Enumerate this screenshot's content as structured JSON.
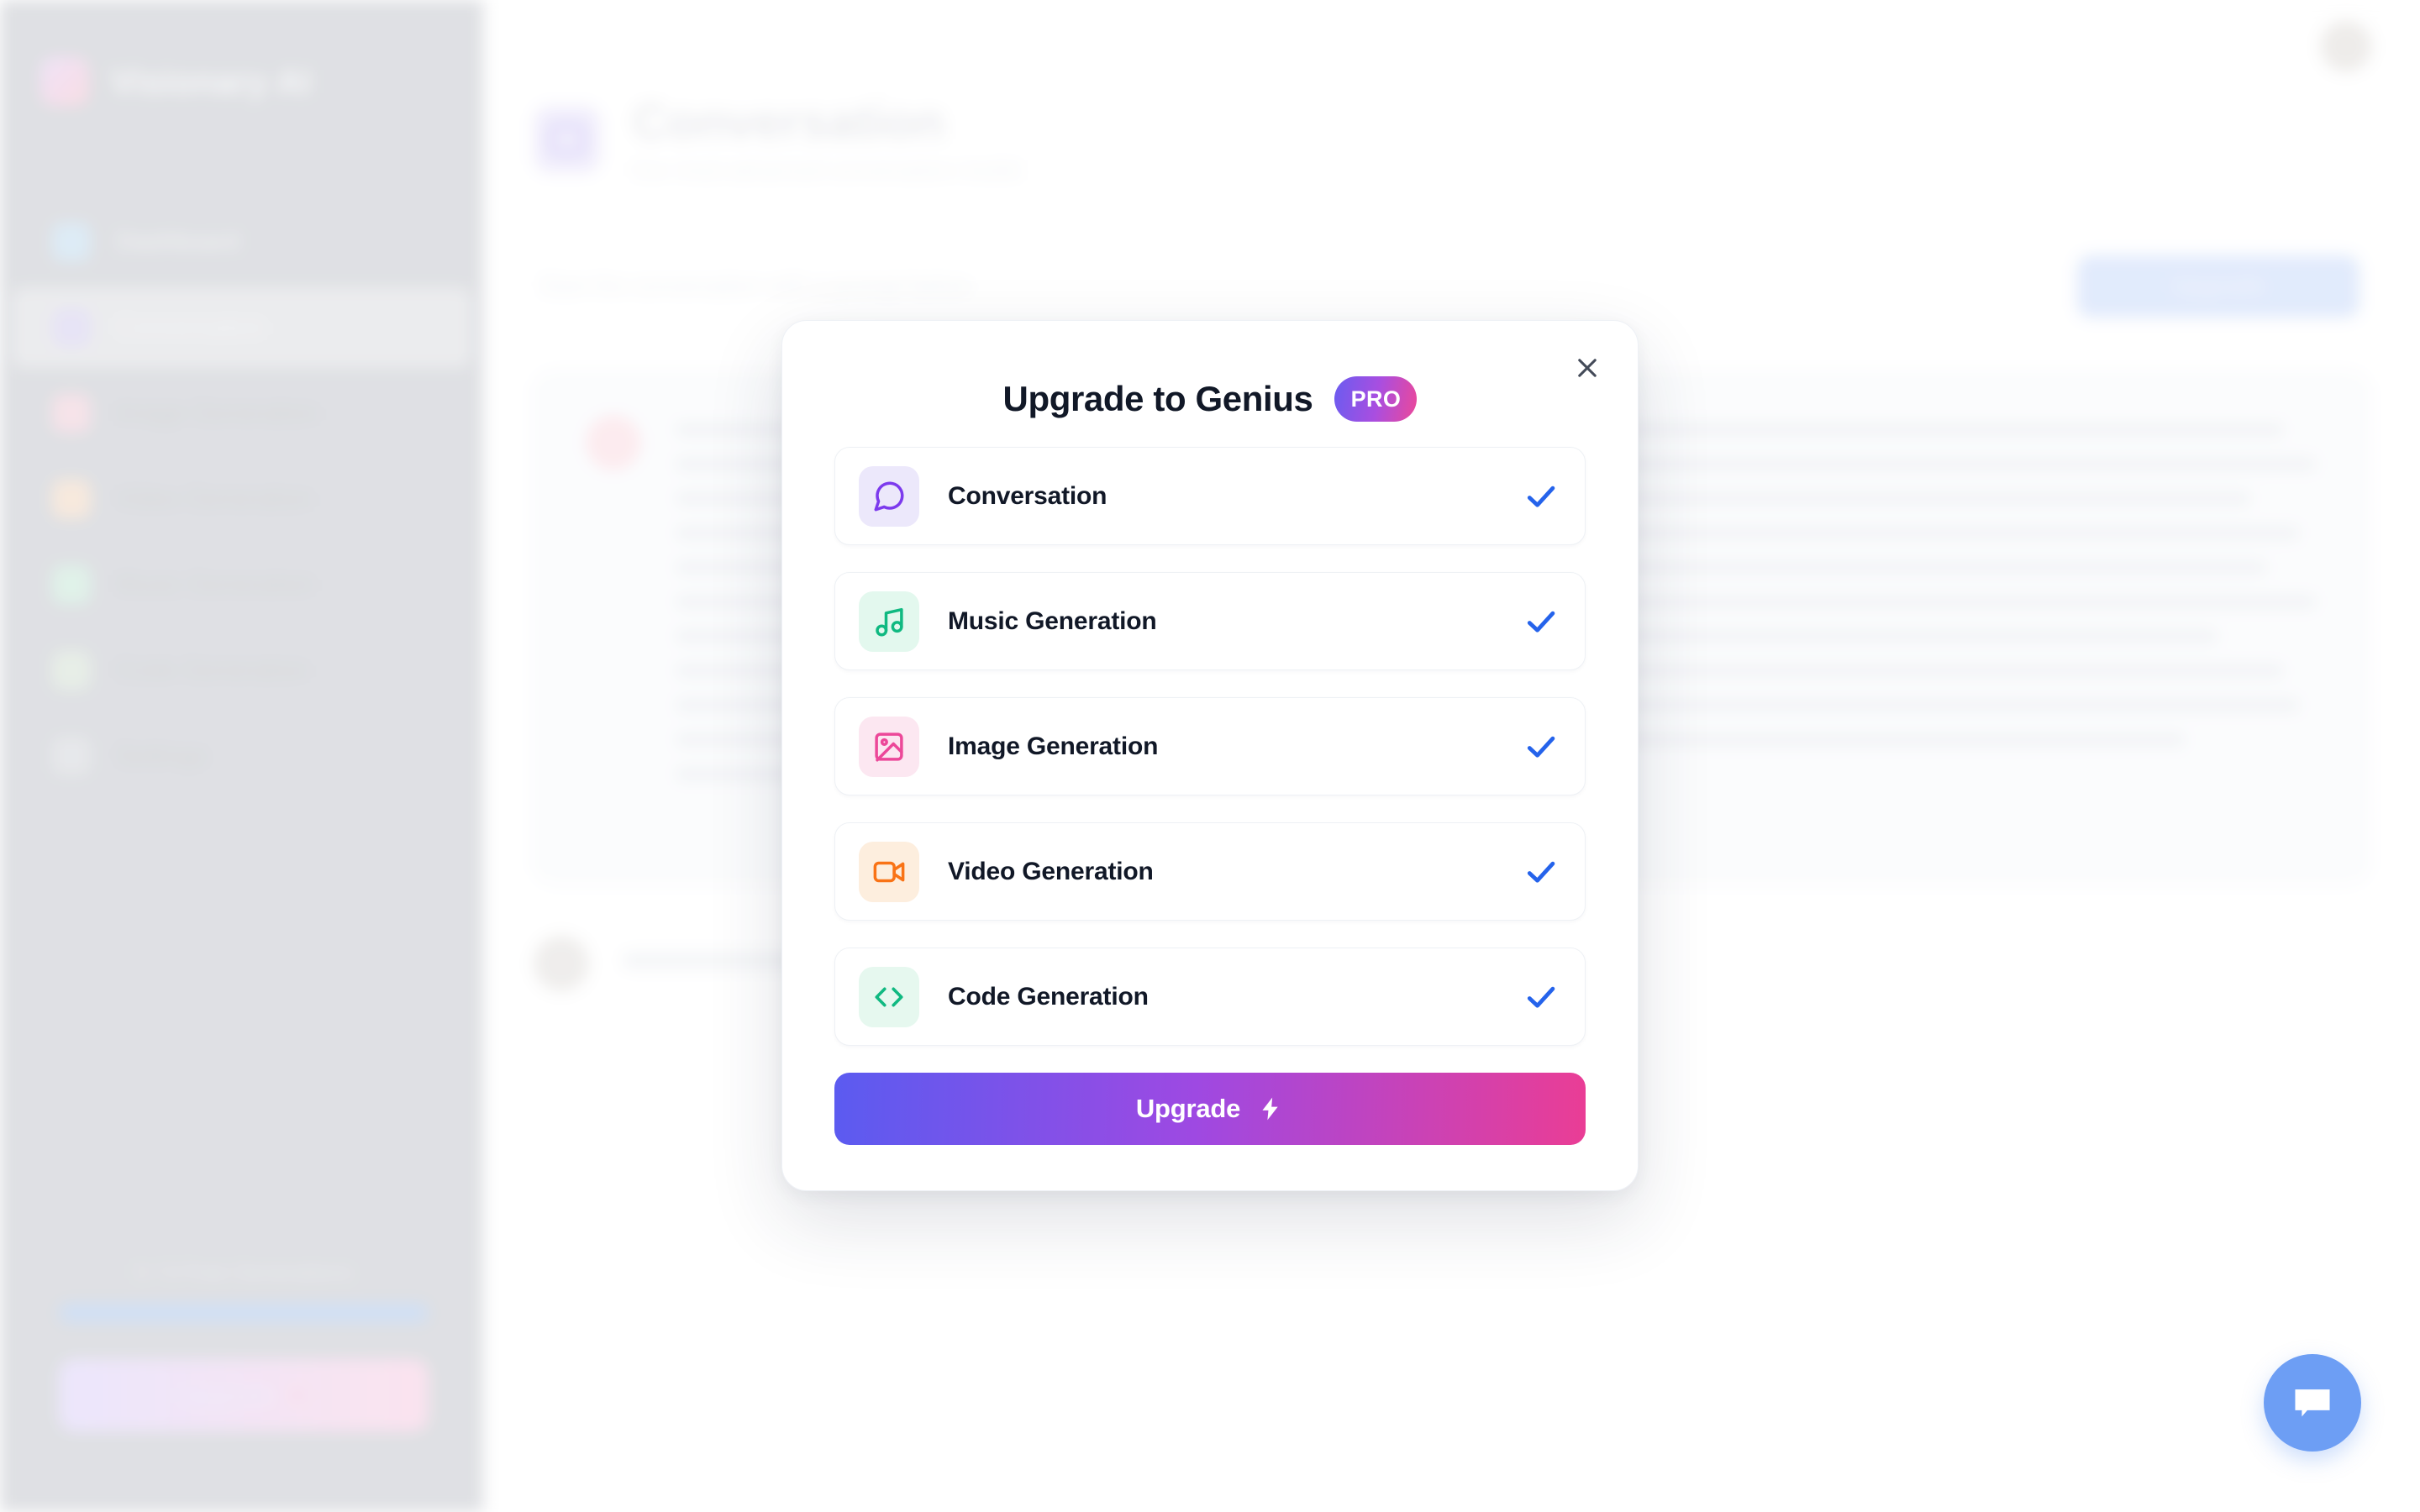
{
  "sidebar": {
    "brand_name": "Visionary AI",
    "logo_icon": "sparkle-logo-icon",
    "items": [
      {
        "label": "Dashboard",
        "icon": "dashboard-icon",
        "active": false
      },
      {
        "label": "Conversation",
        "icon": "chat-bubble-icon",
        "active": true
      },
      {
        "label": "Image Generation",
        "icon": "image-icon",
        "active": false
      },
      {
        "label": "Video Generation",
        "icon": "video-icon",
        "active": false
      },
      {
        "label": "Music Generation",
        "icon": "music-note-icon",
        "active": false
      },
      {
        "label": "Code Generation",
        "icon": "code-brackets-icon",
        "active": false
      },
      {
        "label": "Settings",
        "icon": "gear-icon",
        "active": false
      }
    ],
    "footer": {
      "usage_text": "0 / 5 Free Generations",
      "progress_percent": 100,
      "upgrade_label": "Upgrade",
      "upgrade_icon": "zap-icon"
    }
  },
  "topbar": {
    "avatar_icon": "user-avatar"
  },
  "page_header": {
    "icon": "chat-bubble-icon",
    "title": "Conversation",
    "subtitle": "Our most advanced conversation model."
  },
  "toolbar": {
    "hint_text": "Start the conversation with a prompt below",
    "upgrade_button_label": "Upgrade"
  },
  "conversation": {
    "assistant_message_lines": 11,
    "user_message_label": "Help me learn"
  },
  "chat_widget": {
    "icon": "chat-bubble-icon",
    "color": "#2f74f0"
  },
  "modal": {
    "title": "Upgrade to Genius",
    "badge": "PRO",
    "close_icon": "close-icon",
    "badge_gradient": [
      "#6a5cf0",
      "#ec4899"
    ],
    "check_color": "#2563eb",
    "tools": [
      {
        "label": "Conversation",
        "icon": "chat-bubble-icon",
        "icon_color": "#7c3aed",
        "icon_bg": "#ece8fb",
        "checked": true
      },
      {
        "label": "Music Generation",
        "icon": "music-note-icon",
        "icon_color": "#10b981",
        "icon_bg": "#e3f8ee",
        "checked": true
      },
      {
        "label": "Image Generation",
        "icon": "image-icon",
        "icon_color": "#ec4899",
        "icon_bg": "#fce7f1",
        "checked": true
      },
      {
        "label": "Video Generation",
        "icon": "video-icon",
        "icon_color": "#f97316",
        "icon_bg": "#fdeede",
        "checked": true
      },
      {
        "label": "Code Generation",
        "icon": "code-brackets-icon",
        "icon_color": "#10b981",
        "icon_bg": "#e6f8ef",
        "checked": true
      }
    ],
    "upgrade_button": {
      "label": "Upgrade",
      "icon": "zap-icon",
      "gradient": [
        "#5b5bf0",
        "#9e49e2",
        "#ea3d95"
      ]
    }
  }
}
